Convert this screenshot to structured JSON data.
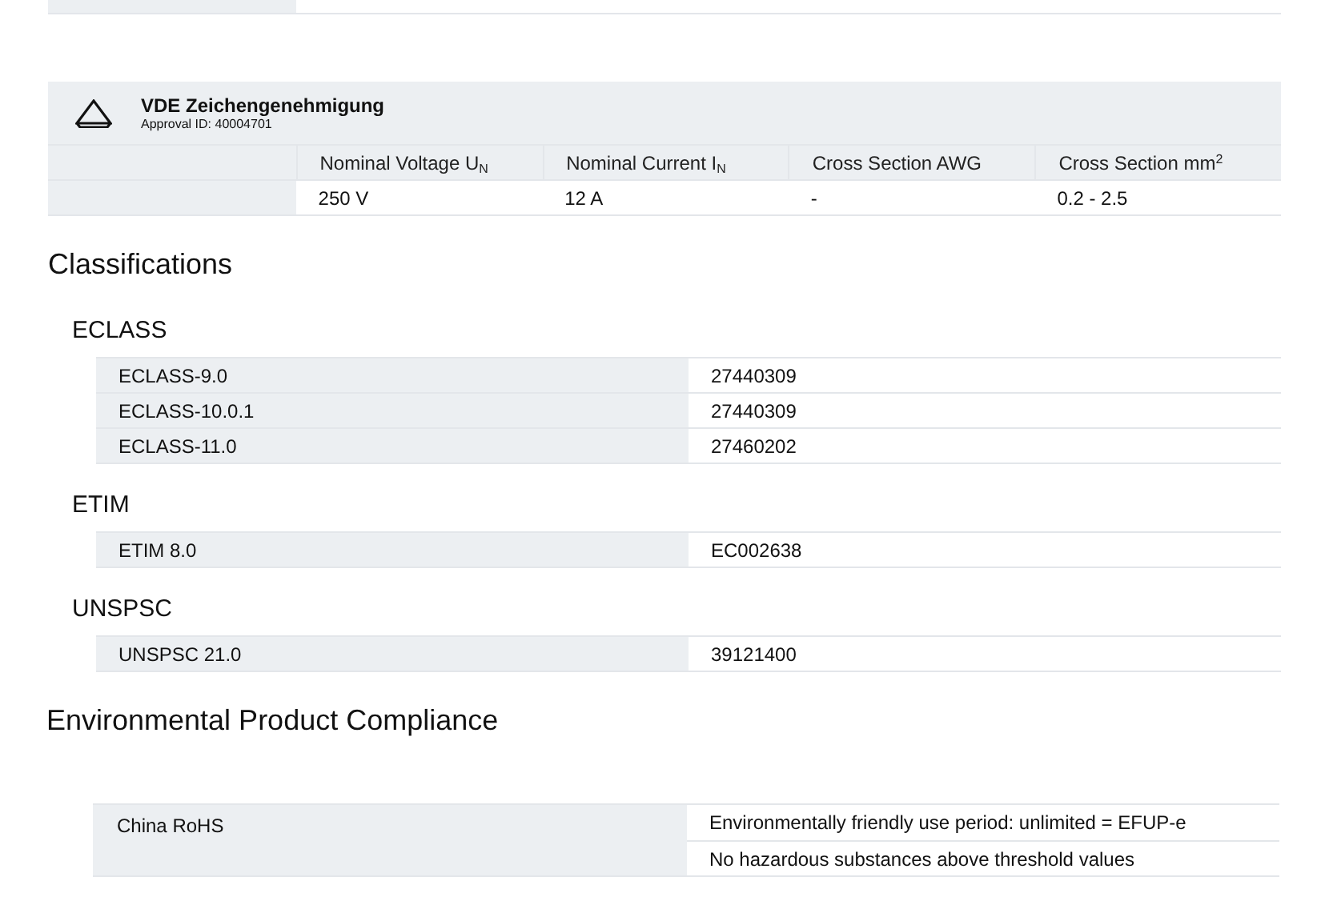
{
  "approval": {
    "title": "VDE Zeichengenehmigung",
    "approval_id": "Approval ID: 40004701",
    "columns": [
      {
        "text": "Nominal Voltage U",
        "sub": "N"
      },
      {
        "text": "Nominal Current I",
        "sub": "N"
      },
      {
        "text": "Cross Section AWG"
      },
      {
        "text": "Cross Section mm",
        "sup": "2"
      }
    ],
    "values": [
      "250 V",
      "12 A",
      "-",
      "0.2 - 2.5"
    ]
  },
  "classifications": {
    "title": "Classifications",
    "groups": [
      {
        "name": "ECLASS",
        "rows": [
          {
            "label": "ECLASS-9.0",
            "value": "27440309"
          },
          {
            "label": "ECLASS-10.0.1",
            "value": "27440309"
          },
          {
            "label": "ECLASS-11.0",
            "value": "27460202"
          }
        ]
      },
      {
        "name": "ETIM",
        "rows": [
          {
            "label": "ETIM 8.0",
            "value": "EC002638"
          }
        ]
      },
      {
        "name": "UNSPSC",
        "rows": [
          {
            "label": "UNSPSC 21.0",
            "value": "39121400"
          }
        ]
      }
    ]
  },
  "compliance": {
    "title": "Environmental Product Compliance",
    "label": "China RoHS",
    "values": [
      "Environmentally friendly use period: unlimited = EFUP-e",
      "No hazardous substances above threshold values"
    ]
  }
}
